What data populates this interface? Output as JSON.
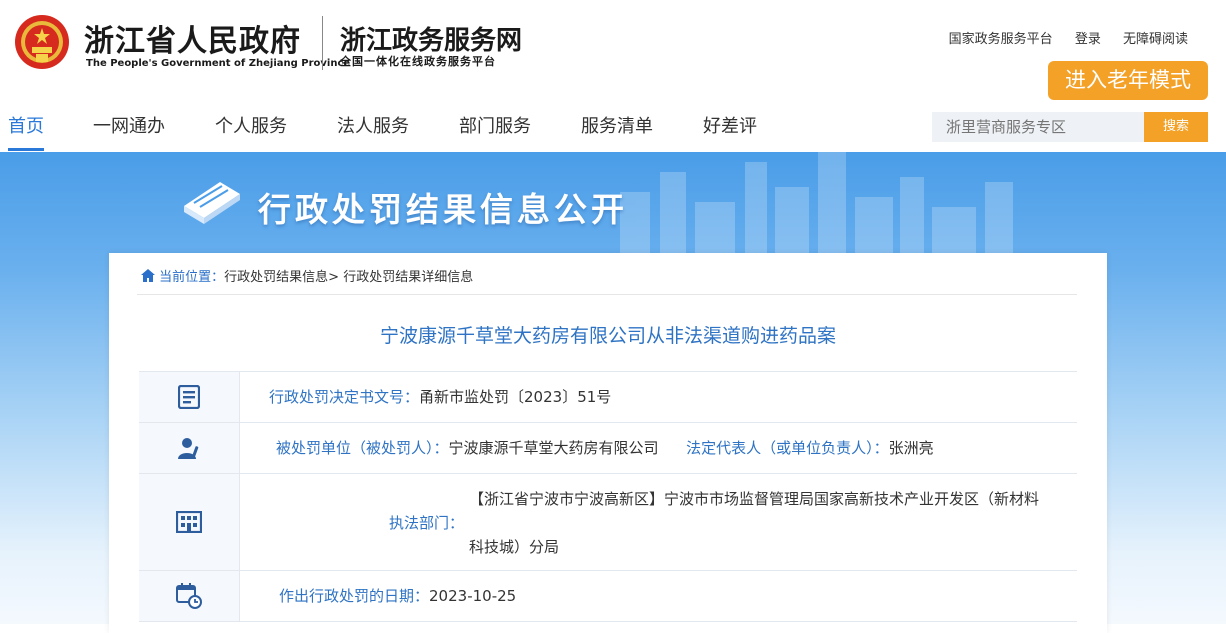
{
  "header": {
    "gov_name_cn": "浙江省人民政府",
    "gov_name_en": "The People's Government of Zhejiang Province",
    "service_name": "浙江政务服务网",
    "service_subtitle": "全国一体化在线政务服务平台",
    "top_links": [
      "国家政务服务平台",
      "登录",
      "无障碍阅读"
    ],
    "elder_mode": "进入老年模式"
  },
  "nav": {
    "items": [
      "首页",
      "一网通办",
      "个人服务",
      "法人服务",
      "部门服务",
      "服务清单",
      "好差评"
    ],
    "active_index": 0
  },
  "search": {
    "placeholder": "浙里营商服务专区",
    "button": "搜索"
  },
  "banner": {
    "title": "行政处罚结果信息公开"
  },
  "breadcrumb": {
    "location_label": "当前位置：",
    "items": [
      "行政处罚结果信息>",
      "行政处罚结果详细信息"
    ]
  },
  "case": {
    "title": "宁波康源千草堂大药房有限公司从非法渠道购进药品案",
    "decision_no_label": "行政处罚决定书文号：",
    "decision_no": "甬新市监处罚〔2023〕51号",
    "punished_label": "被处罚单位（被处罚人）：",
    "punished": "宁波康源千草堂大药房有限公司",
    "legal_rep_label": "法定代表人（或单位负责人）：",
    "legal_rep": "张洲亮",
    "dept_label": "执法部门：",
    "dept_line1": "【浙江省宁波市宁波高新区】宁波市市场监督管理局国家高新技术产业开发区（新材料",
    "dept_line2": "科技城）分局",
    "date_label": "作出行政处罚的日期：",
    "date": "2023-10-25"
  },
  "colors": {
    "accent": "#2a78d8",
    "orange": "#f4a128",
    "label_blue": "#2e73c4"
  },
  "icons": [
    "emblem-icon",
    "book-icon",
    "document-icon",
    "user-icon",
    "building-icon",
    "calendar-clock-icon",
    "home-icon"
  ]
}
